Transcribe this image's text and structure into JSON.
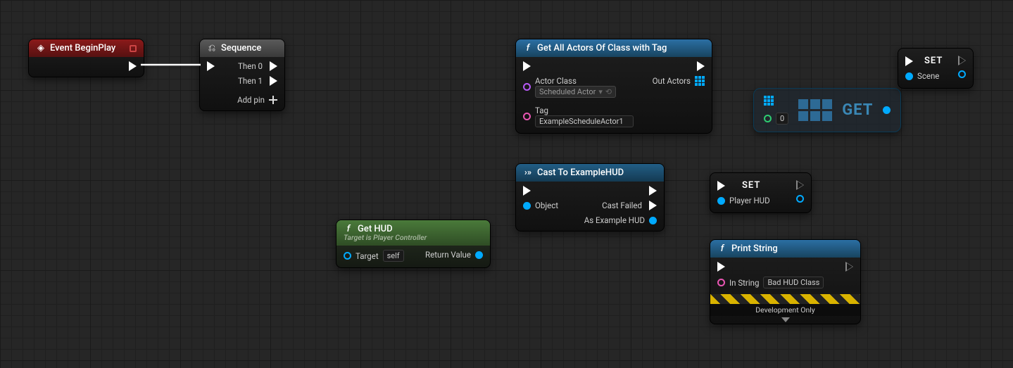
{
  "nodes": {
    "beginplay": {
      "title": "Event BeginPlay"
    },
    "sequence": {
      "title": "Sequence",
      "then0": "Then 0",
      "then1": "Then 1",
      "addpin": "Add pin"
    },
    "getactors": {
      "title": "Get All Actors Of Class with Tag",
      "actorclass_label": "Actor Class",
      "actorclass_value": "Scheduled Actor",
      "tag_label": "Tag",
      "tag_value": "ExampleScheduleActor1",
      "outactors": "Out Actors"
    },
    "get": {
      "label": "GET",
      "index": "0"
    },
    "set1": {
      "title": "SET",
      "var": "Scene"
    },
    "gethud": {
      "title": "Get HUD",
      "sub": "Target is Player Controller",
      "target": "Target",
      "self": "self",
      "return": "Return Value"
    },
    "cast": {
      "title": "Cast To ExampleHUD",
      "object": "Object",
      "castfailed": "Cast Failed",
      "ashud": "As Example HUD"
    },
    "set2": {
      "title": "SET",
      "var": "Player HUD"
    },
    "print": {
      "title": "Print String",
      "instring": "In String",
      "inval": "Bad HUD Class",
      "dev": "Development Only"
    }
  }
}
